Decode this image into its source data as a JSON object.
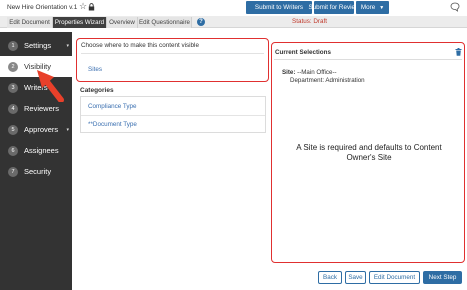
{
  "header": {
    "doc_title": "New Hire Orientation v.1",
    "submit_writers": "Submit to Writers",
    "submit_review": "Submit for Review",
    "more": "More",
    "star_icon": "star-icon",
    "lock_icon": "lock-icon",
    "chat_icon": "chat-bubble-icon"
  },
  "tabs": [
    {
      "label": "Edit Document",
      "active": false
    },
    {
      "label": "Properties Wizard",
      "active": true
    },
    {
      "label": "Overview",
      "active": false
    },
    {
      "label": "Edit Questionnaire",
      "active": false
    }
  ],
  "status": "Status: Draft",
  "sidebar": {
    "items": [
      {
        "num": "1",
        "label": "Settings",
        "caret": "▾"
      },
      {
        "num": "2",
        "label": "Visibility",
        "caret": ""
      },
      {
        "num": "3",
        "label": "Writers",
        "caret": ""
      },
      {
        "num": "4",
        "label": "Reviewers",
        "caret": ""
      },
      {
        "num": "5",
        "label": "Approvers",
        "caret": "▾"
      },
      {
        "num": "6",
        "label": "Assignees",
        "caret": ""
      },
      {
        "num": "7",
        "label": "Security",
        "caret": ""
      }
    ],
    "active_index": 1
  },
  "visibility": {
    "prompt": "Choose where to make this content visible",
    "sites_link": "Sites"
  },
  "categories": {
    "title": "Categories",
    "items": [
      "Compliance Type",
      "**Document Type"
    ]
  },
  "current_selections": {
    "title": "Current Selections",
    "site_label": "Site:",
    "site_value": "--Main Office--",
    "department": "Department: Administration",
    "note": "A Site is required and defaults to Content Owner's Site"
  },
  "footer": {
    "back": "Back",
    "save": "Save",
    "edit_document": "Edit Document",
    "next_step": "Next Step"
  },
  "colors": {
    "primary": "#2e6da4",
    "sidebar_bg": "#333333",
    "highlight_red": "#e03030",
    "status_red": "#c0392b"
  }
}
